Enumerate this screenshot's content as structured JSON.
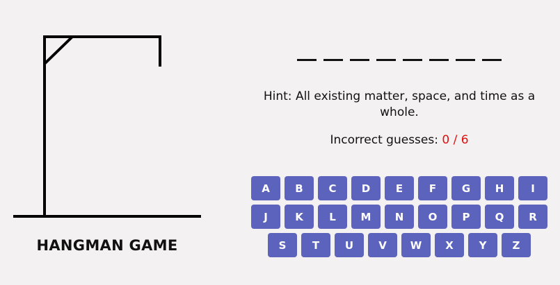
{
  "game": {
    "title": "HANGMAN GAME",
    "word_length": 8,
    "revealed_letters": [
      "",
      "",
      "",
      "",
      "",
      "",
      "",
      ""
    ],
    "hint_label": "Hint:",
    "hint_text": "All existing matter, space, and time as a whole.",
    "incorrect_label": "Incorrect guesses:",
    "incorrect_count": "0 / 6"
  },
  "keyboard": {
    "keys": [
      "A",
      "B",
      "C",
      "D",
      "E",
      "F",
      "G",
      "H",
      "I",
      "J",
      "K",
      "L",
      "M",
      "N",
      "O",
      "P",
      "Q",
      "R",
      "S",
      "T",
      "U",
      "V",
      "W",
      "X",
      "Y",
      "Z"
    ]
  },
  "colors": {
    "key_background": "#5c63bd",
    "key_text": "#ffffff",
    "incorrect_count": "#e01010",
    "background": "#f3f1f1"
  }
}
